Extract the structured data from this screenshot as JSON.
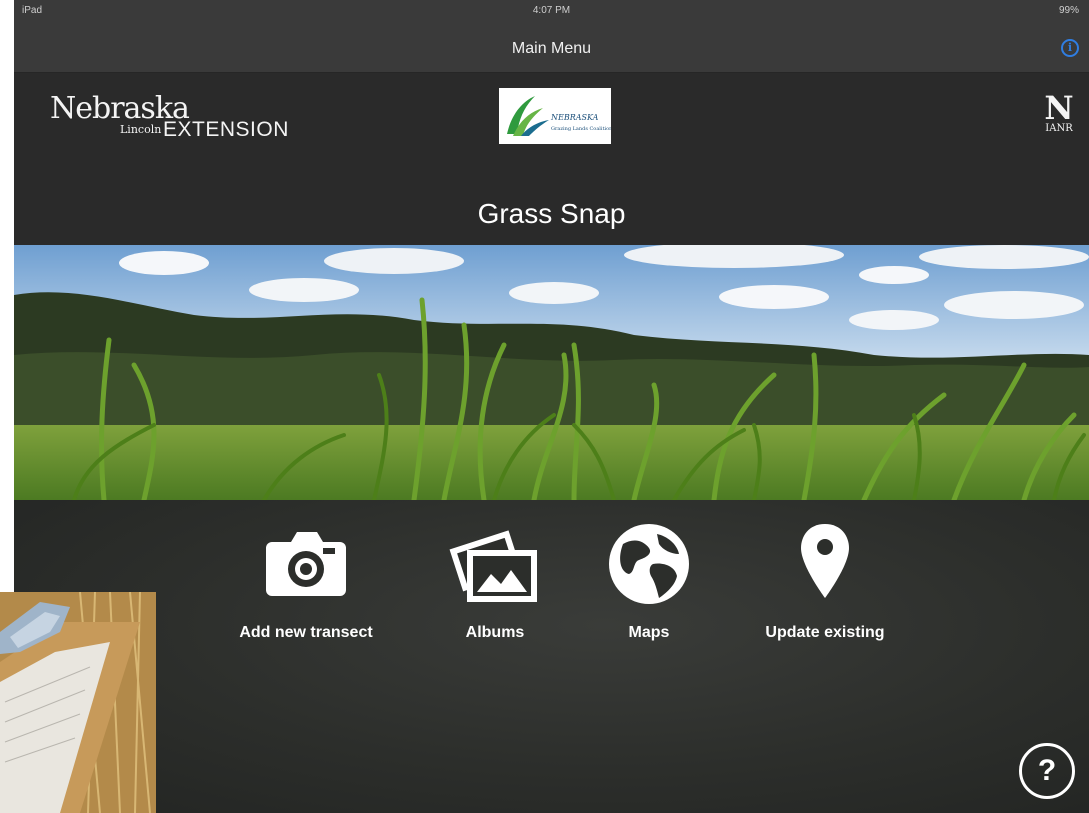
{
  "status_bar": {
    "carrier": "iPad",
    "time": "4:07 PM",
    "battery": "99%"
  },
  "nav": {
    "title": "Main Menu",
    "info_icon": "info-icon"
  },
  "header": {
    "left_logo_text": "Nebraska",
    "left_logo_sub": "Lincoln",
    "left_logo_extension": "EXTENSION",
    "center_logo_text": "NEBRASKA",
    "center_logo_sub": "Grazing Lands Coalition",
    "right_logo_letter": "N",
    "right_logo_text": "IANR"
  },
  "app_title": "Grass Snap",
  "menu": [
    {
      "label": "Add new transect",
      "icon": "camera-icon"
    },
    {
      "label": "Albums",
      "icon": "photo-albums-icon"
    },
    {
      "label": "Maps",
      "icon": "globe-icon"
    },
    {
      "label": "Update existing",
      "icon": "map-pin-icon"
    }
  ],
  "help": {
    "label": "?",
    "icon": "help-icon"
  },
  "colors": {
    "nav_bg": "#3a3a3a",
    "header_bg": "#2a2a2a",
    "accent": "#2f7de1",
    "text": "#ffffff"
  }
}
